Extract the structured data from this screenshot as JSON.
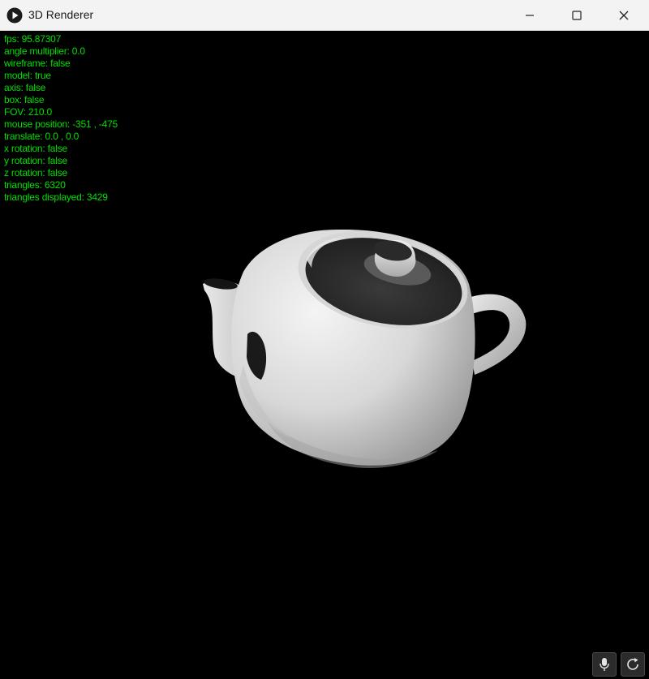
{
  "window": {
    "title": "3D Renderer",
    "app_icon": "play-circle-icon",
    "controls": {
      "minimize_icon": "minimize-icon",
      "maximize_icon": "maximize-icon",
      "close_icon": "close-icon"
    }
  },
  "hud": {
    "color": "#00e000",
    "lines": [
      "fps: 95.87307",
      "angle multiplier: 0.0",
      "wireframe: false",
      "model: true",
      "axis: false",
      "box: false",
      "FOV: 210.0",
      "mouse position: -351 , -475",
      "translate: 0.0 , 0.0",
      "x rotation: false",
      "y rotation: false",
      "z rotation: false",
      "triangles: 6320",
      "triangles displayed: 3429"
    ]
  },
  "scene": {
    "background": "#000000",
    "model": "teapot"
  },
  "overlay_buttons": {
    "mic_icon": "microphone-icon",
    "refresh_icon": "refresh-icon"
  }
}
